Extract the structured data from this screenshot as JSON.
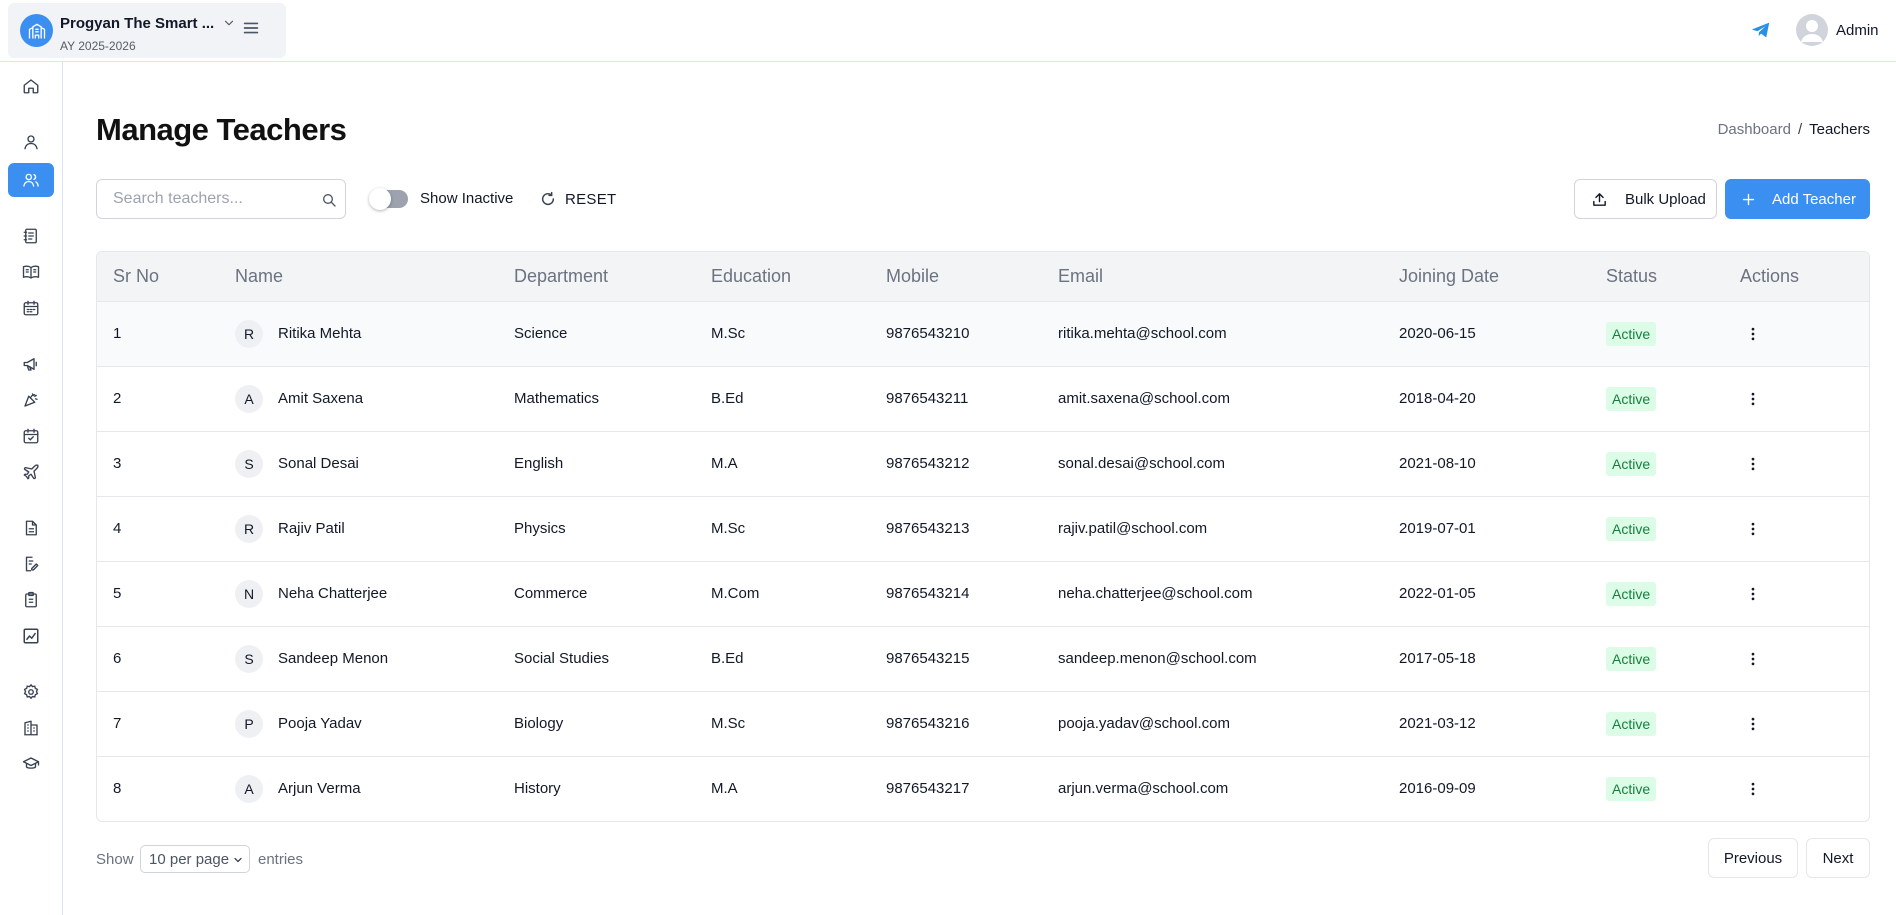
{
  "header": {
    "school_name": "Progyan The Smart ...",
    "academic_year": "AY 2025-2026",
    "user_label": "Admin"
  },
  "page": {
    "title": "Manage Teachers",
    "breadcrumb": [
      "Dashboard",
      "/",
      "Teachers"
    ]
  },
  "toolbar": {
    "search_placeholder": "Search teachers...",
    "show_inactive_label": "Show Inactive",
    "show_inactive_on": false,
    "reset_label": "RESET",
    "bulk_upload_label": "Bulk Upload",
    "add_teacher_label": "Add Teacher"
  },
  "table": {
    "columns": [
      "Sr No",
      "Name",
      "Department",
      "Education",
      "Mobile",
      "Email",
      "Joining Date",
      "Status",
      "Actions"
    ],
    "rows": [
      {
        "sr": "1",
        "initial": "R",
        "name": "Ritika Mehta",
        "department": "Science",
        "education": "M.Sc",
        "mobile": "9876543210",
        "email": "ritika.mehta@school.com",
        "joining": "2020-06-15",
        "status": "Active"
      },
      {
        "sr": "2",
        "initial": "A",
        "name": "Amit Saxena",
        "department": "Mathematics",
        "education": "B.Ed",
        "mobile": "9876543211",
        "email": "amit.saxena@school.com",
        "joining": "2018-04-20",
        "status": "Active"
      },
      {
        "sr": "3",
        "initial": "S",
        "name": "Sonal Desai",
        "department": "English",
        "education": "M.A",
        "mobile": "9876543212",
        "email": "sonal.desai@school.com",
        "joining": "2021-08-10",
        "status": "Active"
      },
      {
        "sr": "4",
        "initial": "R",
        "name": "Rajiv Patil",
        "department": "Physics",
        "education": "M.Sc",
        "mobile": "9876543213",
        "email": "rajiv.patil@school.com",
        "joining": "2019-07-01",
        "status": "Active"
      },
      {
        "sr": "5",
        "initial": "N",
        "name": "Neha Chatterjee",
        "department": "Commerce",
        "education": "M.Com",
        "mobile": "9876543214",
        "email": "neha.chatterjee@school.com",
        "joining": "2022-01-05",
        "status": "Active"
      },
      {
        "sr": "6",
        "initial": "S",
        "name": "Sandeep Menon",
        "department": "Social Studies",
        "education": "B.Ed",
        "mobile": "9876543215",
        "email": "sandeep.menon@school.com",
        "joining": "2017-05-18",
        "status": "Active"
      },
      {
        "sr": "7",
        "initial": "P",
        "name": "Pooja Yadav",
        "department": "Biology",
        "education": "M.Sc",
        "mobile": "9876543216",
        "email": "pooja.yadav@school.com",
        "joining": "2021-03-12",
        "status": "Active"
      },
      {
        "sr": "8",
        "initial": "A",
        "name": "Arjun Verma",
        "department": "History",
        "education": "M.A",
        "mobile": "9876543217",
        "email": "arjun.verma@school.com",
        "joining": "2016-09-09",
        "status": "Active"
      }
    ]
  },
  "pagination": {
    "show_label": "Show",
    "per_page_value": "10 per page",
    "entries_label": "entries",
    "previous_label": "Previous",
    "next_label": "Next"
  },
  "sidebar": {
    "items": [
      {
        "icon": "home-icon"
      },
      {
        "icon": "user-icon"
      },
      {
        "icon": "users-icon",
        "active": true
      },
      {
        "icon": "notebook-icon"
      },
      {
        "icon": "open-book-icon"
      },
      {
        "icon": "calendar-icon"
      },
      {
        "icon": "megaphone-icon"
      },
      {
        "icon": "party-popper-icon"
      },
      {
        "icon": "calendar-check-icon"
      },
      {
        "icon": "plane-icon"
      },
      {
        "icon": "document-icon"
      },
      {
        "icon": "document-edit-icon"
      },
      {
        "icon": "clipboard-icon"
      },
      {
        "icon": "chart-image-icon"
      },
      {
        "icon": "gear-icon"
      },
      {
        "icon": "building-icon"
      },
      {
        "icon": "graduation-cap-icon"
      }
    ]
  },
  "colors": {
    "primary": "#3b8ff0",
    "status_bg": "#dcfce7",
    "status_text": "#15803d"
  }
}
